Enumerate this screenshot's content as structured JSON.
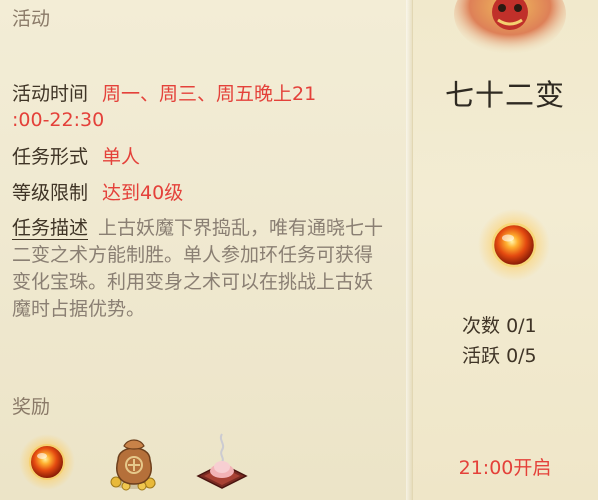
{
  "sections": {
    "activity_title": "活动",
    "reward_title": "奖励"
  },
  "details": {
    "time_label": "活动时间",
    "time_value_line1": "周一、周三、周五晚上21",
    "time_value_line2": ":00-22:30",
    "form_label": "任务形式",
    "form_value": "单人",
    "level_label": "等级限制",
    "level_value": "达到40级",
    "desc_label": "任务描述",
    "desc_value": "上古妖魔下界捣乱，唯有通晓七十二变之术方能制胜。单人参加环任务可获得变化宝珠。利用变身之术可以在挑战上古妖魔时占据优势。"
  },
  "event": {
    "name": "七十二变",
    "count_label": "次数",
    "count_value": "0/1",
    "active_label": "活跃",
    "active_value": "0/5",
    "open_time": "21:00开启"
  },
  "rewards": [
    {
      "icon": "orb-icon"
    },
    {
      "icon": "coin-bag-icon"
    },
    {
      "icon": "incense-icon"
    }
  ],
  "colors": {
    "accent_red": "#e4413a",
    "text_dark": "#3f3426",
    "text_muted": "#8a7a68",
    "panel_bg": "#efe8cf"
  }
}
